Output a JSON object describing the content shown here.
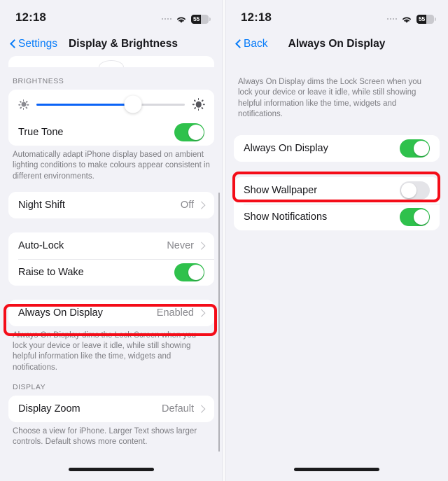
{
  "left_panel": {
    "status": {
      "time": "12:18",
      "battery_level": "55",
      "wifi_icon": "wifi-icon",
      "cellular_icon": "cellular-dots-icon"
    },
    "nav": {
      "back_label": "Settings",
      "title": "Display & Brightness"
    },
    "brightness_group": {
      "header": "BRIGHTNESS",
      "slider": {
        "name": "brightness-slider",
        "value": 65,
        "low_icon": "sun-small-icon",
        "high_icon": "sun-large-icon"
      },
      "true_tone": {
        "label": "True Tone",
        "state": "on"
      },
      "footnote": "Automatically adapt iPhone display based on ambient lighting conditions to make colours appear consistent in different environments."
    },
    "night_shift": {
      "label": "Night Shift",
      "value": "Off"
    },
    "lock_group": {
      "auto_lock": {
        "label": "Auto-Lock",
        "value": "Never"
      },
      "raise_to_wake": {
        "label": "Raise to Wake",
        "state": "on"
      }
    },
    "always_on": {
      "label": "Always On Display",
      "value": "Enabled",
      "footnote": "Always On Display dims the Lock Screen when you lock your device or leave it idle, while still showing helpful information like the time, widgets and notifications."
    },
    "display_group": {
      "header": "DISPLAY",
      "display_zoom": {
        "label": "Display Zoom",
        "value": "Default"
      },
      "footnote": "Choose a view for iPhone. Larger Text shows larger controls. Default shows more content."
    }
  },
  "right_panel": {
    "status": {
      "time": "12:18",
      "battery_level": "55",
      "wifi_icon": "wifi-icon",
      "cellular_icon": "cellular-dots-icon"
    },
    "nav": {
      "back_label": "Back",
      "title": "Always On Display"
    },
    "intro_footnote": "Always On Display dims the Lock Screen when you lock your device or leave it idle, while still showing helpful information like the time, widgets and notifications.",
    "always_on_display": {
      "label": "Always On Display",
      "state": "on"
    },
    "show_wallpaper": {
      "label": "Show Wallpaper",
      "state": "off"
    },
    "show_notifications": {
      "label": "Show Notifications",
      "state": "on"
    }
  },
  "annotations": {
    "highlight_color": "#f40c18",
    "highlight_1_target": "always-on-display-row",
    "highlight_2_target": "show-wallpaper-row"
  },
  "colors": {
    "accent_blue": "#067bf9",
    "toggle_green": "#2fc14c",
    "slider_blue": "#0b63f6",
    "background": "#f2f2f7",
    "card": "#ffffff",
    "secondary_text": "#7d7d82"
  }
}
